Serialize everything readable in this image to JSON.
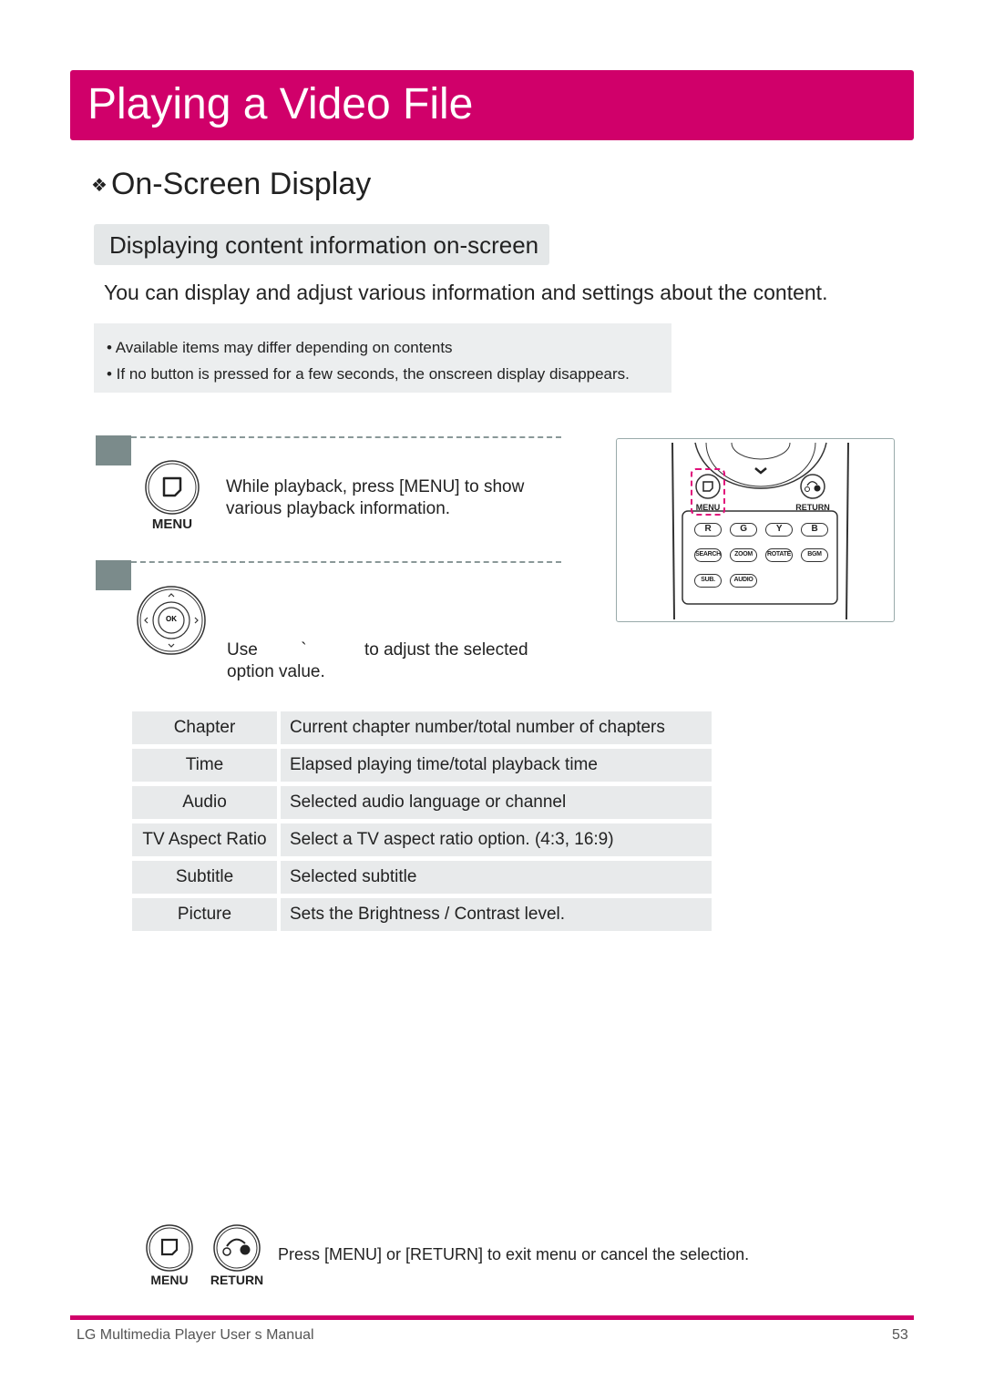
{
  "page_title": "Playing a Video File",
  "section_title": "On-Screen Display",
  "subheading": "Displaying content information on-screen",
  "intro": "You can display and adjust various information and settings about the content.",
  "notes": [
    "• Available items may differ depending on contents",
    "• If no button is pressed for a few seconds, the onscreen display disappears."
  ],
  "steps": [
    {
      "button_label": "MENU",
      "text_line1": "While playback, press [MENU]  to show",
      "text_line2": "various playback information."
    },
    {
      "button_label": "OK",
      "text_line1": "Use         `            to adjust the selected",
      "text_line2": "option value."
    }
  ],
  "remote": {
    "menu": "MENU",
    "return": "RETURN",
    "row1": [
      "R",
      "G",
      "Y",
      "B"
    ],
    "row2": [
      "SEARCH",
      "ZOOM",
      "ROTATE",
      "BGM"
    ],
    "row3": [
      "SUB.",
      "AUDIO"
    ],
    "highlight_color": "#e0107a"
  },
  "table": [
    {
      "item": "Chapter",
      "desc": "Current chapter number/total number of chapters"
    },
    {
      "item": "Time",
      "desc": "Elapsed playing time/total playback time"
    },
    {
      "item": "Audio",
      "desc": "Selected audio language or channel"
    },
    {
      "item": "TV Aspect Ratio",
      "desc": "Select a TV aspect ratio option. (4:3, 16:9)"
    },
    {
      "item": "Subtitle",
      "desc": "Selected subtitle"
    },
    {
      "item": "Picture",
      "desc": "Sets the Brightness / Contrast level."
    }
  ],
  "exit": {
    "menu_label": "MENU",
    "return_label": "RETURN",
    "text": "Press [MENU] or [RETURN] to exit menu or cancel the selection."
  },
  "footer": {
    "left": "LG Multimedia Player User s Manual",
    "page": "53"
  },
  "colors": {
    "accent": "#d0006a",
    "step_marker": "#7b8b8b",
    "panel": "#e8eaeb"
  }
}
